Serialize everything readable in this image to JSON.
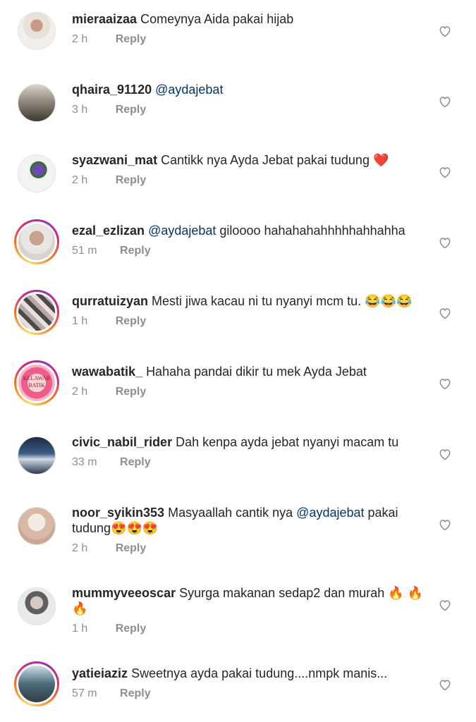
{
  "comments": [
    {
      "username": "mieraaizaa",
      "segments": [
        {
          "text": "Comeynya Aida pakai hijab",
          "type": "text"
        }
      ],
      "time": "2 h",
      "reply": "Reply",
      "avatar_icon": "user-avatar",
      "story_ring": false
    },
    {
      "username": "qhaira_91120",
      "segments": [
        {
          "text": "@aydajebat",
          "type": "mention"
        }
      ],
      "time": "3 h",
      "reply": "Reply",
      "avatar_icon": "user-avatar",
      "story_ring": false
    },
    {
      "username": "syazwani_mat",
      "segments": [
        {
          "text": "Cantikk nya Ayda Jebat pakai tudung ❤️",
          "type": "text"
        }
      ],
      "time": "2 h",
      "reply": "Reply",
      "avatar_icon": "user-avatar",
      "story_ring": false
    },
    {
      "username": "ezal_ezlizan",
      "segments": [
        {
          "text": "@aydajebat",
          "type": "mention"
        },
        {
          "text": " giloooo hahahahahhhhhahhahha",
          "type": "text"
        }
      ],
      "time": "51 m",
      "reply": "Reply",
      "avatar_icon": "user-avatar",
      "story_ring": true
    },
    {
      "username": "qurratuizyan",
      "segments": [
        {
          "text": "Mesti jiwa kacau ni tu nyanyi mcm tu. 😂😂😂",
          "type": "text"
        }
      ],
      "time": "1 h",
      "reply": "Reply",
      "avatar_icon": "user-avatar",
      "story_ring": true
    },
    {
      "username": "wawabatik_",
      "segments": [
        {
          "text": "Hahaha pandai dikir tu mek Ayda Jebat",
          "type": "text"
        }
      ],
      "time": "2 h",
      "reply": "Reply",
      "avatar_icon": "user-avatar",
      "story_ring": true,
      "avatar_caption": "KELAWAR BATIK"
    },
    {
      "username": "civic_nabil_rider",
      "segments": [
        {
          "text": "Dah kenpa ayda jebat nyanyi macam tu",
          "type": "text"
        }
      ],
      "time": "33 m",
      "reply": "Reply",
      "avatar_icon": "user-avatar",
      "story_ring": false
    },
    {
      "username": "noor_syikin353",
      "segments": [
        {
          "text": "Masyaallah cantik nya ",
          "type": "text"
        },
        {
          "text": "@aydajebat",
          "type": "mention"
        },
        {
          "text": "  pakai tudung😍😍😍",
          "type": "text"
        }
      ],
      "time": "2 h",
      "reply": "Reply",
      "avatar_icon": "user-avatar",
      "story_ring": false
    },
    {
      "username": "mummyveeoscar",
      "segments": [
        {
          "text": "Syurga makanan sedap2 dan murah 🔥 🔥 🔥",
          "type": "text"
        }
      ],
      "time": "1 h",
      "reply": "Reply",
      "avatar_icon": "user-avatar",
      "story_ring": false
    },
    {
      "username": "yatieiaziz",
      "segments": [
        {
          "text": "Sweetnya ayda pakai tudung....nmpk manis...",
          "type": "text"
        }
      ],
      "time": "57 m",
      "reply": "Reply",
      "avatar_icon": "user-avatar",
      "story_ring": true
    }
  ],
  "like_icon": "heart-outline-icon",
  "colors": {
    "text": "#262626",
    "muted": "#8e8e8e",
    "mention": "#00376b",
    "background": "#ffffff"
  }
}
